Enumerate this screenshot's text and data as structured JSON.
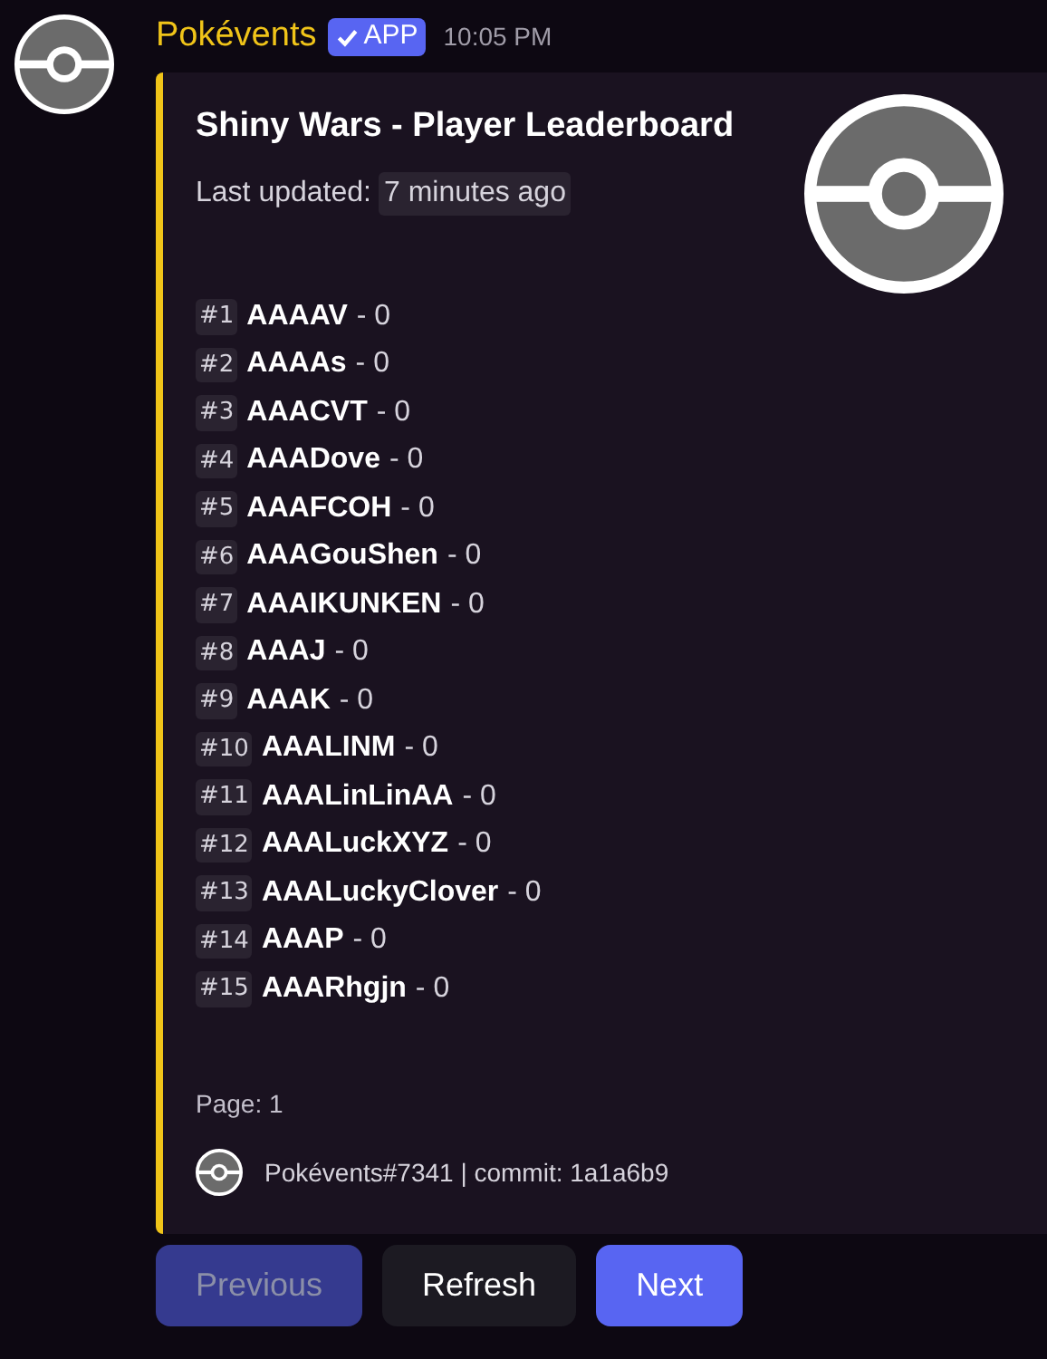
{
  "message": {
    "author": "Pokévents",
    "badge": "APP",
    "time": "10:05 PM"
  },
  "embed": {
    "title": "Shiny Wars - Player Leaderboard",
    "updated_label": "Last updated:",
    "updated_value": "7 minutes ago",
    "rows": [
      {
        "rank": "#1",
        "name": "AAAAV",
        "score": "- 0"
      },
      {
        "rank": "#2",
        "name": "AAAAs",
        "score": "- 0"
      },
      {
        "rank": "#3",
        "name": "AAACVT",
        "score": "- 0"
      },
      {
        "rank": "#4",
        "name": "AAADove",
        "score": "- 0"
      },
      {
        "rank": "#5",
        "name": "AAAFCOH",
        "score": "- 0"
      },
      {
        "rank": "#6",
        "name": "AAAGouShen",
        "score": "- 0"
      },
      {
        "rank": "#7",
        "name": "AAAIKUNKEN",
        "score": "- 0"
      },
      {
        "rank": "#8",
        "name": "AAAJ",
        "score": "- 0"
      },
      {
        "rank": "#9",
        "name": "AAAK",
        "score": "- 0"
      },
      {
        "rank": "#10",
        "name": "AAALINM",
        "score": "- 0"
      },
      {
        "rank": "#11",
        "name": "AAALinLinAA",
        "score": "- 0"
      },
      {
        "rank": "#12",
        "name": "AAALuckXYZ",
        "score": "- 0"
      },
      {
        "rank": "#13",
        "name": "AAALuckyClover",
        "score": "- 0"
      },
      {
        "rank": "#14",
        "name": "AAAP",
        "score": "- 0"
      },
      {
        "rank": "#15",
        "name": "AAARhgjn",
        "score": "- 0"
      }
    ],
    "page": "Page: 1",
    "footer": "Pokévents#7341 | commit: 1a1a6b9"
  },
  "buttons": [
    {
      "label": "Previous",
      "kind": "primary",
      "disabled": true
    },
    {
      "label": "Refresh",
      "kind": "secondary",
      "disabled": false
    },
    {
      "label": "Next",
      "kind": "primary",
      "disabled": false
    }
  ]
}
